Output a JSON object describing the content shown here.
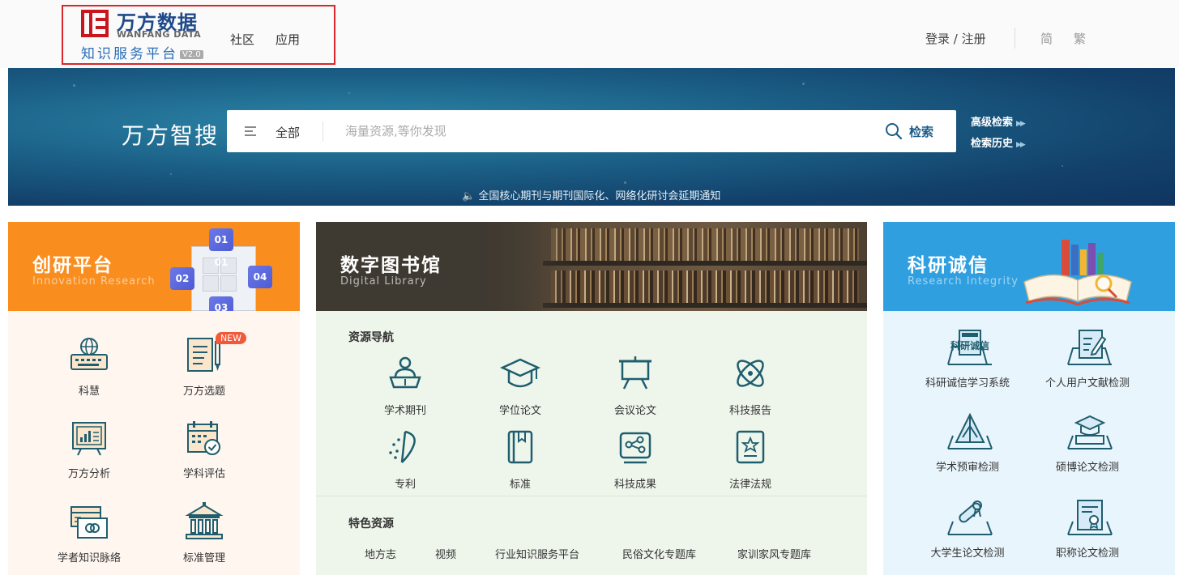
{
  "header": {
    "logo_cn": "万方数据",
    "logo_en": "WANFANG DATA",
    "logo_sub": "知识服务平台",
    "logo_version": "V2.0",
    "nav": [
      "社区",
      "应用"
    ],
    "login": "登录 / 注册",
    "lang_simplified": "简",
    "lang_traditional": "繁"
  },
  "search": {
    "brand": "万方智搜",
    "scope": "全部",
    "placeholder": "海量资源,等你发现",
    "button": "检索",
    "advanced": "高级检索",
    "history": "检索历史"
  },
  "notice": "全国核心期刊与期刊国际化、网络化研讨会延期通知",
  "panels": {
    "innovation": {
      "title": "创研平台",
      "subtitle": "Innovation Research",
      "cube_labels": [
        "01 01",
        "02",
        "04",
        "03"
      ],
      "items": [
        {
          "label": "科慧",
          "icon": "keyboard-globe-icon"
        },
        {
          "label": "万方选题",
          "icon": "document-pen-icon",
          "badge": "NEW"
        },
        {
          "label": "万方分析",
          "icon": "chart-board-icon"
        },
        {
          "label": "学科评估",
          "icon": "calendar-check-icon"
        },
        {
          "label": "学者知识脉络",
          "icon": "cards-icon"
        },
        {
          "label": "标准管理",
          "icon": "institution-icon"
        }
      ]
    },
    "library": {
      "title": "数字图书馆",
      "subtitle": "Digital Library",
      "nav_title": "资源导航",
      "items": [
        {
          "label": "学术期刊",
          "icon": "reader-icon"
        },
        {
          "label": "学位论文",
          "icon": "graduation-cap-icon"
        },
        {
          "label": "会议论文",
          "icon": "easel-icon"
        },
        {
          "label": "科技报告",
          "icon": "atom-icon"
        },
        {
          "label": "专利",
          "icon": "spark-icon"
        },
        {
          "label": "标准",
          "icon": "book-icon"
        },
        {
          "label": "科技成果",
          "icon": "nodes-icon"
        },
        {
          "label": "法律法规",
          "icon": "law-icon"
        }
      ],
      "feature_title": "特色资源",
      "features": [
        "地方志",
        "视频",
        "行业知识服务平台",
        "民俗文化专题库",
        "家训家风专题库"
      ]
    },
    "integrity": {
      "title": "科研诚信",
      "subtitle": "Research Integrity",
      "book_label": "科研诚信",
      "items": [
        {
          "label": "科研诚信学习系统",
          "icon": "study-book-icon"
        },
        {
          "label": "个人用户文献检测",
          "icon": "doc-check-icon"
        },
        {
          "label": "学术预审检测",
          "icon": "pyramid-icon"
        },
        {
          "label": "硕博论文检测",
          "icon": "cap-box-icon"
        },
        {
          "label": "大学生论文检测",
          "icon": "diploma-icon"
        },
        {
          "label": "职称论文检测",
          "icon": "certificate-icon"
        }
      ]
    }
  },
  "colors": {
    "innovation": "#f98e1f",
    "library": "#3f3a31",
    "integrity": "#2f9fe0",
    "icon_teal": "#1f5e6e",
    "highlight_border": "#d9262c"
  }
}
